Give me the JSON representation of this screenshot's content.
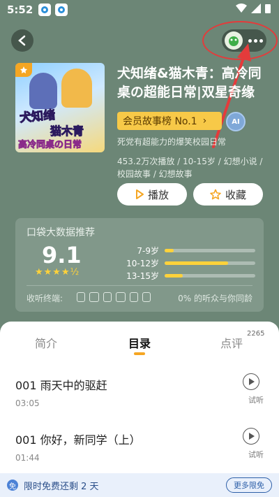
{
  "status_bar": {
    "time": "5:52"
  },
  "header": {},
  "book": {
    "title": "犬知绪&猫木青：高冷同桌の超能日常|双星奇缘",
    "cover_text_1": "犬知绪",
    "cover_text_2": "猫木青",
    "cover_text_3": "高冷同桌の日常",
    "rank_label": "会员故事榜 No.1",
    "ai_label": "AI",
    "tagline": "死党有超能力的爆笑校园日常",
    "meta_line": "453.2万次播放 / 10-15岁 / 幻想小说 / 校园故事 / 幻想故事",
    "play_label": "播放",
    "fav_label": "收藏"
  },
  "data_card": {
    "title": "口袋大数据推荐",
    "score": "9.1",
    "stars": "★★★★½",
    "ages": [
      {
        "label": "7-9岁",
        "fraction": 0.1
      },
      {
        "label": "10-12岁",
        "fraction": 0.7
      },
      {
        "label": "13-15岁",
        "fraction": 0.2
      }
    ],
    "terminal_label": "收听终端:",
    "same_age_text": "0% 的听众与你同龄"
  },
  "tabs": {
    "intro": "简介",
    "catalog": "目录",
    "review": "点评",
    "review_count": "2265"
  },
  "episodes": [
    {
      "title": "001 雨天中的驱赶",
      "duration": "03:05",
      "trial": "试听"
    },
    {
      "title": "001 你好，新同学（上）",
      "duration": "01:44",
      "trial": "试听"
    }
  ],
  "promo": {
    "text": "限时免费还剩 2 天",
    "button": "更多限免"
  },
  "colors": {
    "background": "#6c8676",
    "accent": "#f7c948",
    "highlight_red": "#e43b3b"
  }
}
